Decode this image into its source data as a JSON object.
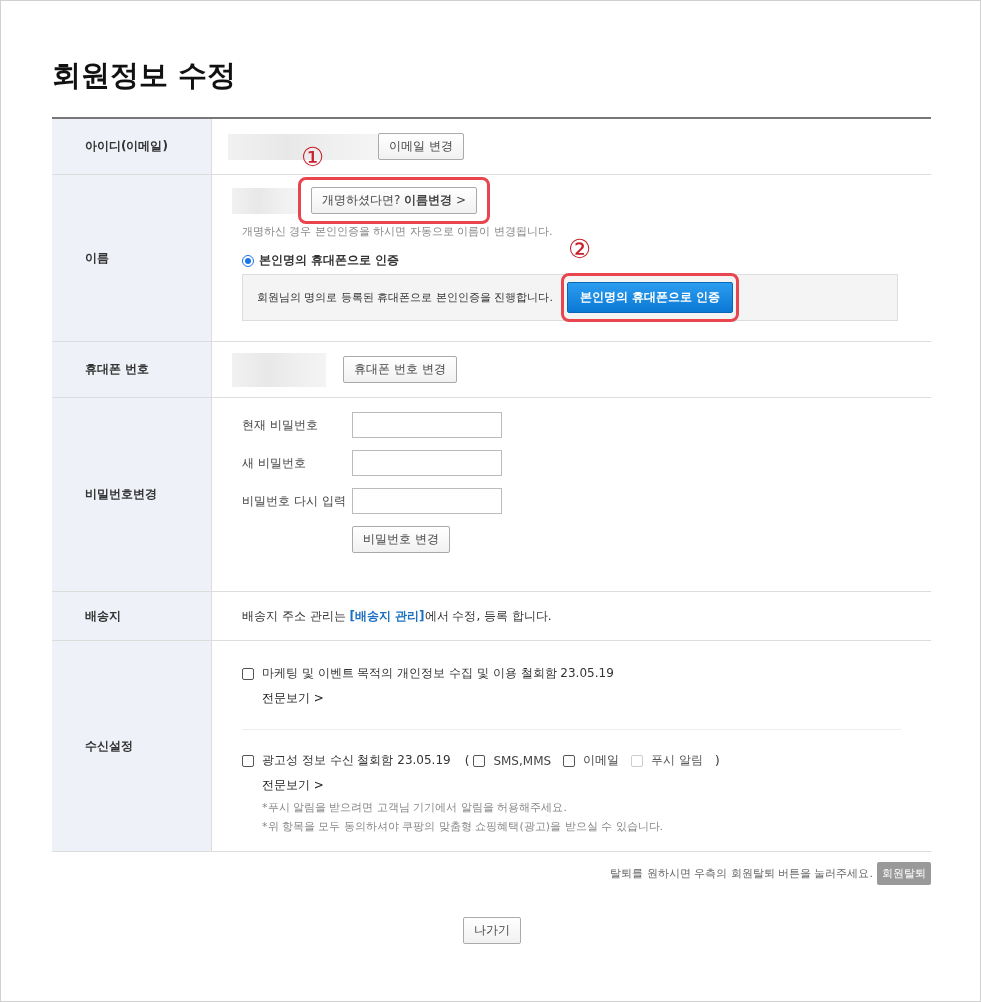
{
  "title": "회원정보 수정",
  "id_row": {
    "label": "아이디(이메일)",
    "button": "이메일 변경"
  },
  "name_row": {
    "label": "이름",
    "button": "개명하셨다면? **이름변경** >",
    "marker_1": "①",
    "note": "개명하신 경우 본인인증을 하시면 자동으로 이름이 변경됩니다.",
    "radio": {
      "label": "본인명의 휴대폰으로 인증",
      "selected": true
    },
    "verify_text": "회원님의 명의로 등록된 휴대폰으로 본인인증을 진행합니다.",
    "verify_button": "본인명의 휴대폰으로 인증",
    "marker_2": "②"
  },
  "phone_row": {
    "label": "휴대폰 번호",
    "button": "휴대폰 번호 변경"
  },
  "password_row": {
    "label": "비밀번호변경",
    "fields": [
      {
        "label": "현재 비밀번호"
      },
      {
        "label": "새 비밀번호"
      },
      {
        "label": "비밀번호 다시 입력"
      }
    ],
    "button": "비밀번호 변경"
  },
  "shipping_row": {
    "label": "배송지",
    "before": "배송지 주소 관리는 ",
    "link": "[배송지 관리]",
    "after": "에서 수정, 등록 합니다."
  },
  "consent_row": {
    "label": "수신설정",
    "items": [
      {
        "label": "마케팅 및 이벤트 목적의 개인정보 수집 및 이용 철회함 23.05.19",
        "checked": false,
        "more": "전문보기 >"
      },
      {
        "label": "광고성 정보 수신 철회함 23.05.19",
        "checked": false,
        "more": "전문보기 >",
        "open": "(",
        "close": ")",
        "options": [
          {
            "label": "SMS,MMS",
            "checked": false,
            "disabled": false
          },
          {
            "label": "이메일",
            "checked": false,
            "disabled": false
          },
          {
            "label": "푸시 알림",
            "checked": false,
            "disabled": true
          }
        ],
        "notes": [
          "*푸시 알림을 받으려면 고객님 기기에서 알림을 허용해주세요.",
          "*위 항목을 모두 동의하셔야 쿠팡의 맞춤형 쇼핑혜택(광고)을 받으실 수 있습니다."
        ]
      }
    ]
  },
  "withdraw": {
    "text": "탈퇴를 원하시면 우측의 회원탈퇴 버튼을 눌러주세요.",
    "button": "회원탈퇴"
  },
  "exit_button": "나가기"
}
